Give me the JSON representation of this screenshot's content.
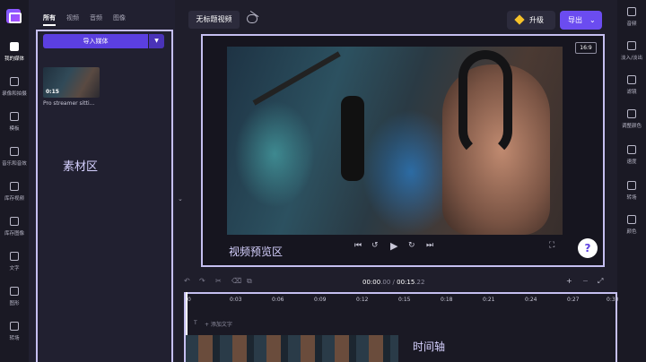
{
  "left_rail": {
    "items": [
      {
        "label": "我的媒体",
        "icon": "folder-icon",
        "active": true
      },
      {
        "label": "录像和拍摄",
        "icon": "camera-icon",
        "active": false
      },
      {
        "label": "模板",
        "icon": "template-icon",
        "active": false
      },
      {
        "label": "音乐和音效",
        "icon": "music-icon",
        "active": false
      },
      {
        "label": "库存视频",
        "icon": "video-library-icon",
        "active": false
      },
      {
        "label": "库存图像",
        "icon": "image-library-icon",
        "active": false
      },
      {
        "label": "文字",
        "icon": "text-icon",
        "active": false
      },
      {
        "label": "图形",
        "icon": "shapes-icon",
        "active": false
      },
      {
        "label": "转场",
        "icon": "transition-icon",
        "active": false
      }
    ]
  },
  "media_panel": {
    "tabs": [
      "所有",
      "视频",
      "音频",
      "图像"
    ],
    "active_tab": "所有",
    "import_label": "导入媒体",
    "asset": {
      "duration": "0:15",
      "title": "Pro streamer sitti..."
    },
    "area_label": "素材区"
  },
  "header": {
    "project_title": "无标题视频",
    "upgrade_label": "升级",
    "export_label": "导出"
  },
  "preview": {
    "aspect_ratio": "16:9",
    "area_label": "视频预览区",
    "help_label": "?"
  },
  "right_rail": {
    "items": [
      {
        "label": "音频",
        "icon": "speaker-icon"
      },
      {
        "label": "淡入/淡出",
        "icon": "fade-icon"
      },
      {
        "label": "滤镜",
        "icon": "filter-icon"
      },
      {
        "label": "调整颜色",
        "icon": "adjust-color-icon"
      },
      {
        "label": "速度",
        "icon": "speed-icon"
      },
      {
        "label": "转场",
        "icon": "transition-icon"
      },
      {
        "label": "颜色",
        "icon": "palette-icon"
      }
    ]
  },
  "timeline": {
    "current_time": "00:00",
    "current_frac": ".00",
    "separator": " / ",
    "total_time": "00:15",
    "total_frac": ".22",
    "ticks": [
      "0",
      "0:03",
      "0:06",
      "0:09",
      "0:12",
      "0:15",
      "0:18",
      "0:21",
      "0:24",
      "0:27",
      "0:30"
    ],
    "add_text_label": "+ 添加文字",
    "area_label": "时间轴"
  }
}
